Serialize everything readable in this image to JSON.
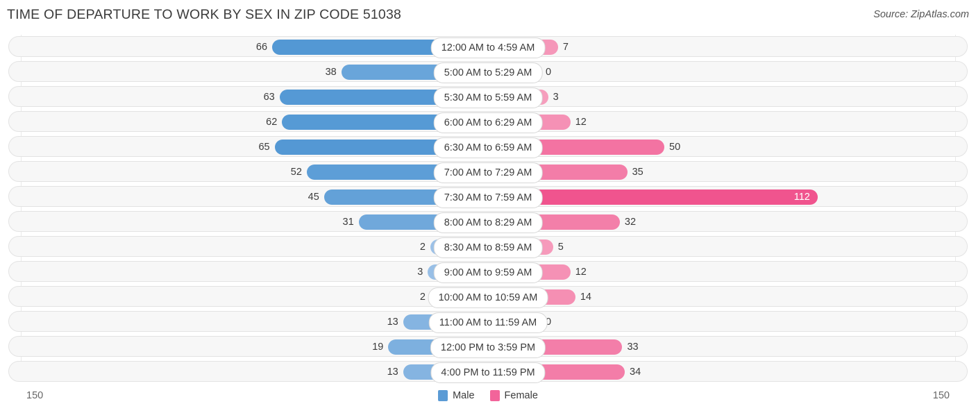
{
  "header": {
    "title": "TIME OF DEPARTURE TO WORK BY SEX IN ZIP CODE 51038",
    "source": "Source: ZipAtlas.com"
  },
  "legend": {
    "male_label": "Male",
    "female_label": "Female",
    "male_color": "#5b9bd5",
    "female_color": "#f2649a"
  },
  "axis": {
    "left_label": "150",
    "right_label": "150"
  },
  "chart_data": {
    "type": "bar",
    "orientation": "horizontal-diverging",
    "title": "TIME OF DEPARTURE TO WORK BY SEX IN ZIP CODE 51038",
    "subtitle": "Source: ZipAtlas.com",
    "xlabel": "",
    "ylabel": "",
    "xlim": [
      -150,
      150
    ],
    "axis_ticks": [
      "150",
      "150"
    ],
    "grid": true,
    "legend_position": "bottom-center",
    "categories": [
      "12:00 AM to 4:59 AM",
      "5:00 AM to 5:29 AM",
      "5:30 AM to 5:59 AM",
      "6:00 AM to 6:29 AM",
      "6:30 AM to 6:59 AM",
      "7:00 AM to 7:29 AM",
      "7:30 AM to 7:59 AM",
      "8:00 AM to 8:29 AM",
      "8:30 AM to 8:59 AM",
      "9:00 AM to 9:59 AM",
      "10:00 AM to 10:59 AM",
      "11:00 AM to 11:59 AM",
      "12:00 PM to 3:59 PM",
      "4:00 PM to 11:59 PM"
    ],
    "series": [
      {
        "name": "Male",
        "color": "#5b9bd5",
        "values": [
          66,
          38,
          63,
          62,
          65,
          52,
          45,
          31,
          2,
          3,
          2,
          13,
          19,
          13
        ]
      },
      {
        "name": "Female",
        "color": "#f2649a",
        "values": [
          7,
          0,
          3,
          12,
          50,
          35,
          112,
          32,
          5,
          12,
          14,
          0,
          33,
          34
        ]
      }
    ]
  }
}
